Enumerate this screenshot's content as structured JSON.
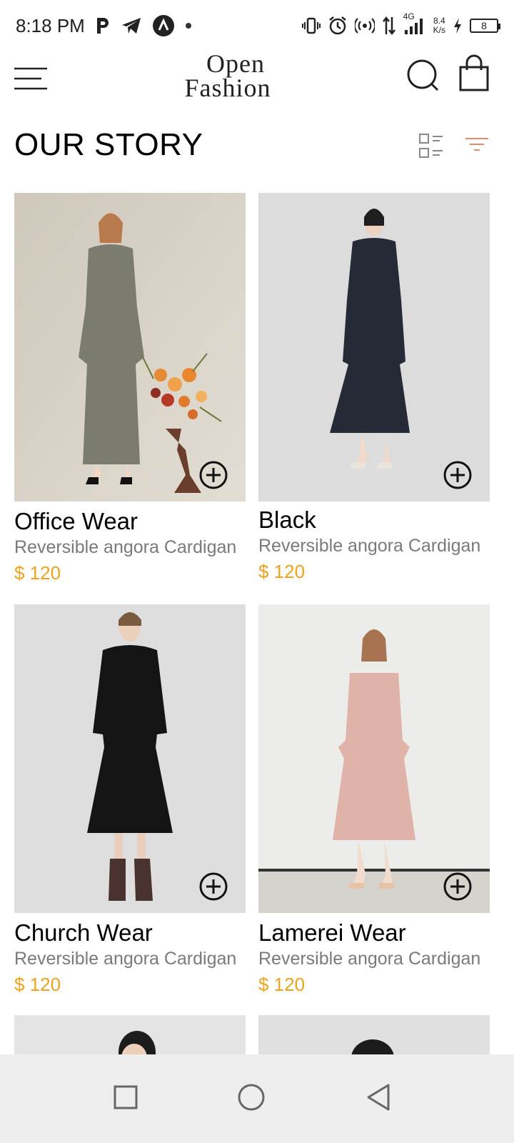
{
  "status_bar": {
    "time": "8:18 PM",
    "network_type": "4G",
    "net_speed_value": "8.4",
    "net_speed_unit": "K/s",
    "battery_level": "8"
  },
  "header": {
    "logo_line1": "Open",
    "logo_line2": "Fashion"
  },
  "section": {
    "title": "OUR STORY"
  },
  "colors": {
    "accent_price": "#f0a21e",
    "filter_icon": "#e98a6a"
  },
  "products": [
    {
      "title": "Office Wear",
      "subtitle": "Reversible angora Cardigan",
      "price": "$ 120"
    },
    {
      "title": "Black",
      "subtitle": "Reversible angora Cardigan",
      "price": "$ 120"
    },
    {
      "title": "Church Wear",
      "subtitle": "Reversible angora Cardigan",
      "price": "$ 120"
    },
    {
      "title": "Lamerei Wear",
      "subtitle": "Reversible angora Cardigan",
      "price": "$ 120"
    }
  ]
}
